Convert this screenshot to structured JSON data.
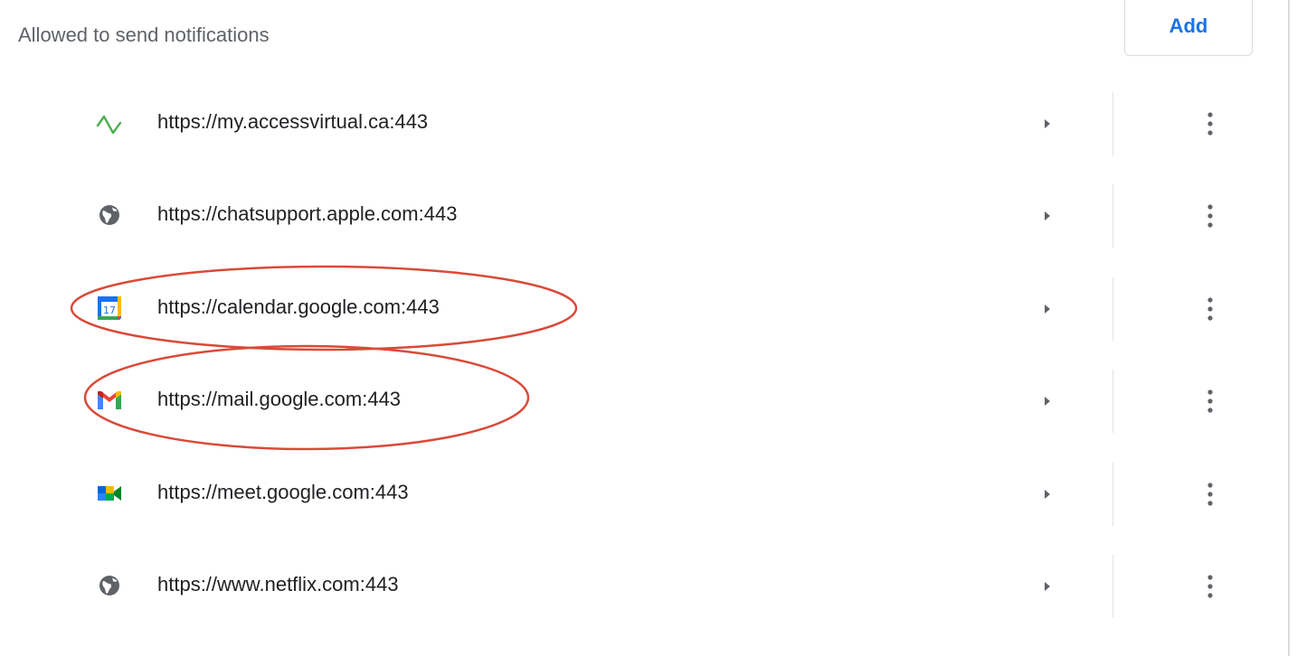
{
  "section": {
    "title": "Allowed to send notifications",
    "add_label": "Add"
  },
  "sites": [
    {
      "url": "https://my.accessvirtual.ca:443",
      "icon": "accessvirtual-pulse-icon"
    },
    {
      "url": "https://chatsupport.apple.com:443",
      "icon": "globe-icon"
    },
    {
      "url": "https://calendar.google.com:443",
      "icon": "google-calendar-icon",
      "icon_text": "17"
    },
    {
      "url": "https://mail.google.com:443",
      "icon": "gmail-icon"
    },
    {
      "url": "https://meet.google.com:443",
      "icon": "google-meet-icon"
    },
    {
      "url": "https://www.netflix.com:443",
      "icon": "globe-icon"
    }
  ],
  "colors": {
    "accent": "#1a73e8",
    "annotation": "#d94a38",
    "pulse": "#4caf50"
  }
}
